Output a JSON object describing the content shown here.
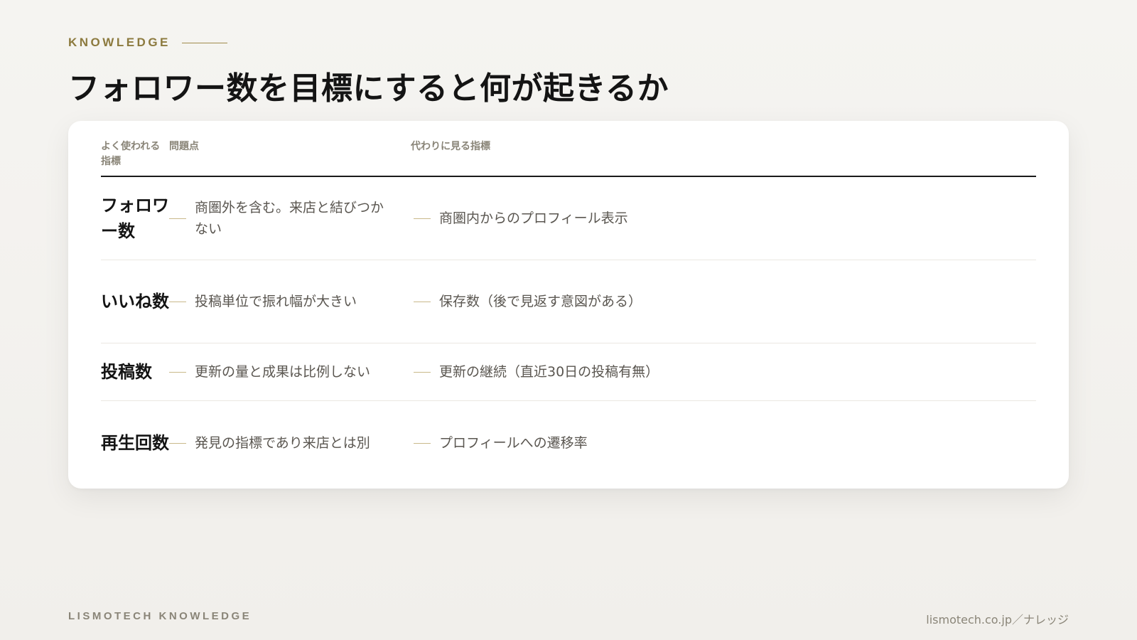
{
  "header": {
    "eyebrow": "KNOWLEDGE",
    "title": "フォロワー数を目標にすると何が起きるか"
  },
  "table": {
    "columns": {
      "metric": "よく使われる指標",
      "problem": "問題点",
      "alternative": "代わりに見る指標"
    },
    "rows": [
      {
        "metric": "フォロワー数",
        "problem": "商圏外を含む。来店と結びつかない",
        "alternative": "商圏内からのプロフィール表示"
      },
      {
        "metric": "いいね数",
        "problem": "投稿単位で振れ幅が大きい",
        "alternative": "保存数（後で見返す意図がある）"
      },
      {
        "metric": "投稿数",
        "problem": "更新の量と成果は比例しない",
        "alternative": "更新の継続（直近30日の投稿有無）"
      },
      {
        "metric": "再生回数",
        "problem": "発見の指標であり来店とは別",
        "alternative": "プロフィールへの遷移率"
      }
    ]
  },
  "footer": {
    "brand": "LISMOTECH KNOWLEDGE",
    "url": "lismotech.co.jp／ナレッジ"
  },
  "colors": {
    "accent": "#8c7a3e",
    "background": "#f3f2ee",
    "card": "#ffffff",
    "title": "#141414",
    "muted": "#8a8578"
  }
}
